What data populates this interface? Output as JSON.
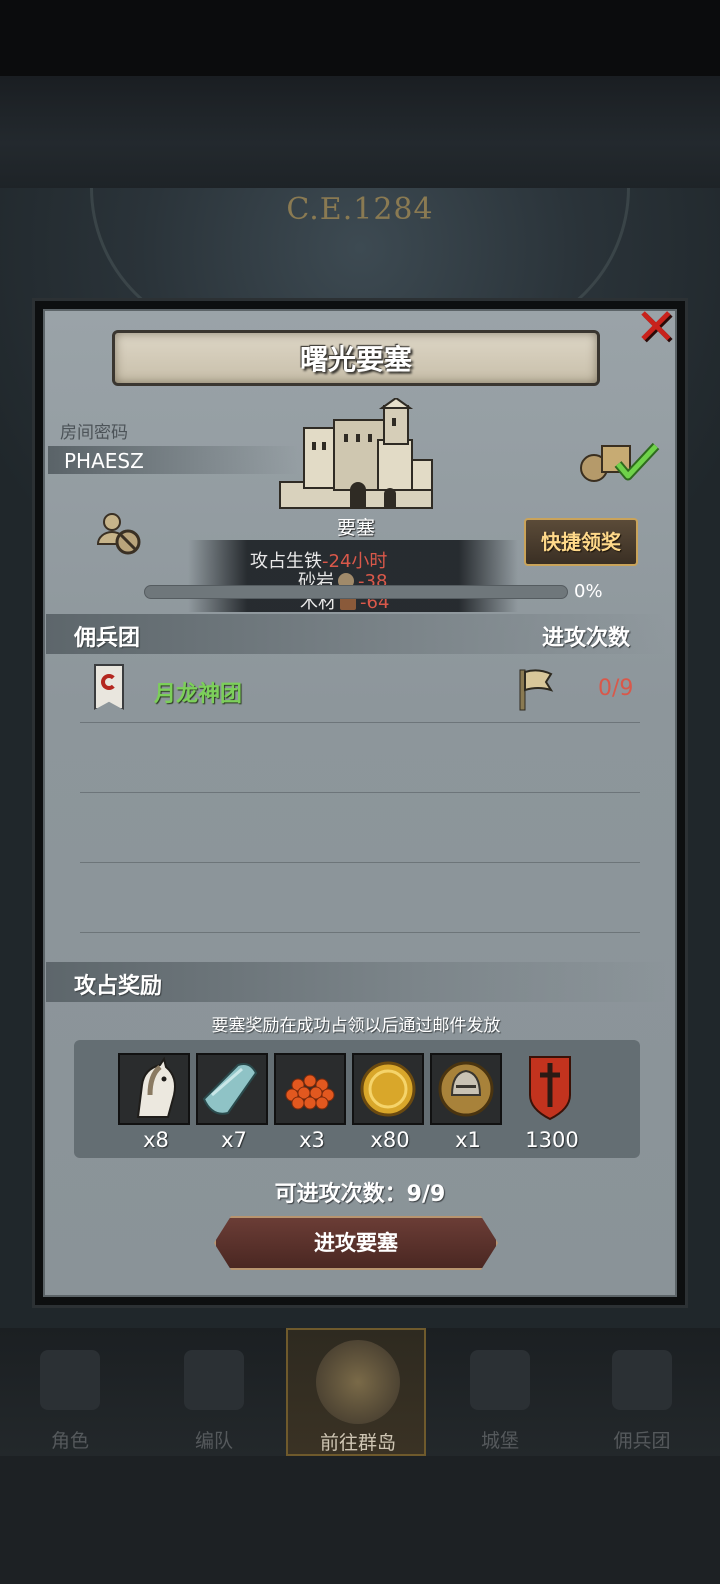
{
  "header": {
    "year": "C.E.1284"
  },
  "dialog": {
    "title": "曙光要塞",
    "room_label": "房间密码",
    "room_code": "PHAESZ",
    "building_label": "要塞",
    "quick_claim_label": "快捷领奖",
    "cost": [
      {
        "name": "攻占生铁",
        "value": "-24小时"
      },
      {
        "name": "砂岩",
        "value": "-38"
      },
      {
        "name": "木材",
        "value": "-64"
      }
    ],
    "progress_text": "0%",
    "progress_value": 0
  },
  "mercenary_section": {
    "title": "佣兵团",
    "right_title": "进攻次数",
    "rows": [
      {
        "name": "月龙神团",
        "count": "0/9"
      }
    ]
  },
  "reward_section": {
    "title": "攻占奖励",
    "note": "要塞奖励在成功占领以后通过邮件发放",
    "items": [
      {
        "icon": "horse-icon",
        "qty": "x8"
      },
      {
        "icon": "cloth-icon",
        "qty": "x7"
      },
      {
        "icon": "berries-icon",
        "qty": "x3"
      },
      {
        "icon": "gold-coin-icon",
        "qty": "x80"
      },
      {
        "icon": "helmet-icon",
        "qty": "x1"
      },
      {
        "icon": "shield-sword-icon",
        "qty": "1300"
      }
    ]
  },
  "attempts_text": "可进攻次数：9/9",
  "attack_button_label": "进攻要塞",
  "nav": [
    {
      "label": "角色",
      "icon": "knight-icon",
      "active": false
    },
    {
      "label": "编队",
      "icon": "helmet-icon",
      "active": false
    },
    {
      "label": "前往群岛",
      "icon": "compass-icon",
      "active": true
    },
    {
      "label": "城堡",
      "icon": "castle-icon",
      "active": false
    },
    {
      "label": "佣兵团",
      "icon": "ship-icon",
      "active": false
    }
  ],
  "colors": {
    "accent_gold": "#c9a35a",
    "cost_red": "#d9584a",
    "merc_green": "#7ccf5a",
    "close_red": "#c8221c"
  }
}
